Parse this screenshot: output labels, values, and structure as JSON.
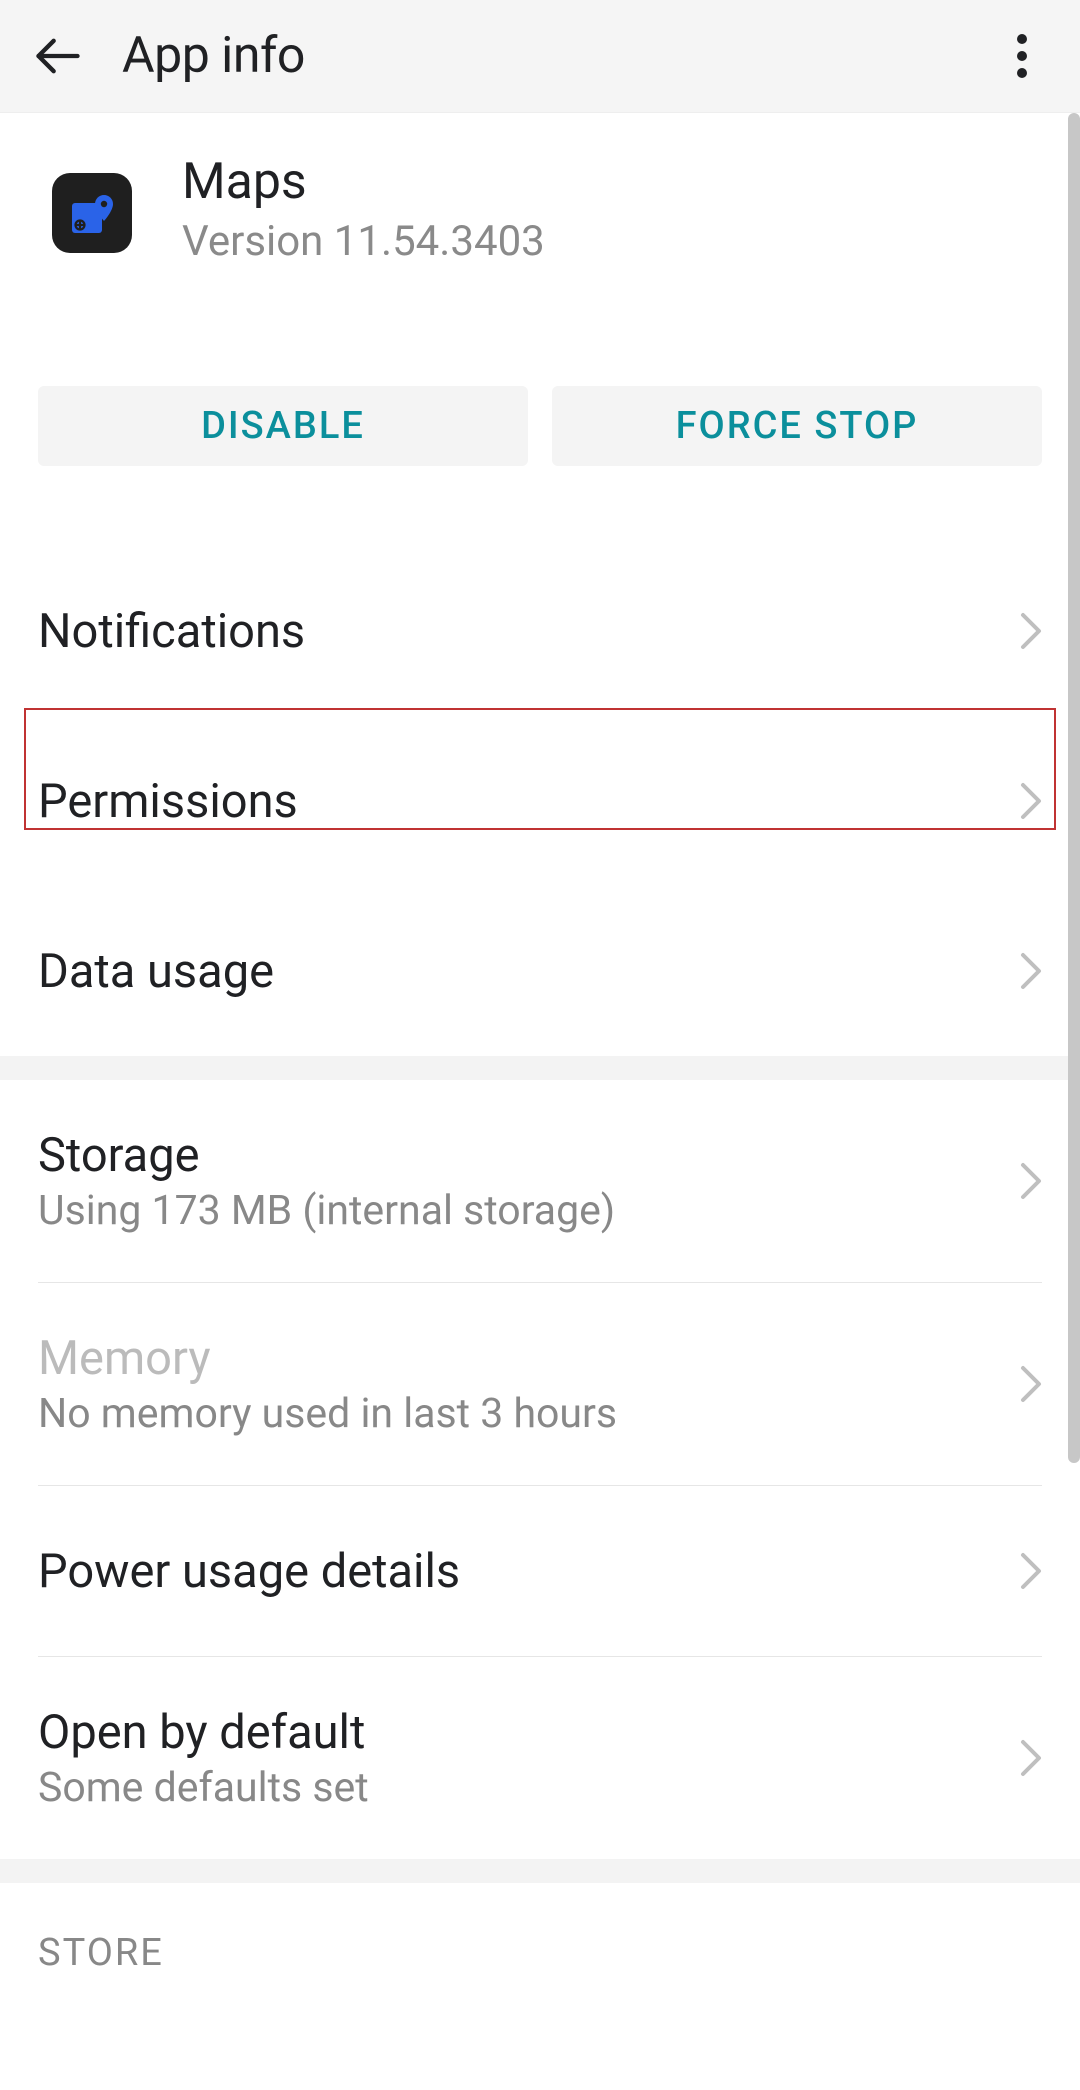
{
  "header": {
    "title": "App info"
  },
  "app": {
    "name": "Maps",
    "version_label": "Version 11.54.3403"
  },
  "buttons": {
    "disable": "DISABLE",
    "force_stop": "FORCE STOP"
  },
  "rows": {
    "notifications": "Notifications",
    "permissions": "Permissions",
    "data_usage": "Data usage",
    "storage_title": "Storage",
    "storage_sub": "Using 173 MB (internal storage)",
    "memory_title": "Memory",
    "memory_sub": "No memory used in last 3 hours",
    "power_usage": "Power usage details",
    "open_default_title": "Open by default",
    "open_default_sub": "Some defaults set"
  },
  "sections": {
    "store": "STORE"
  }
}
